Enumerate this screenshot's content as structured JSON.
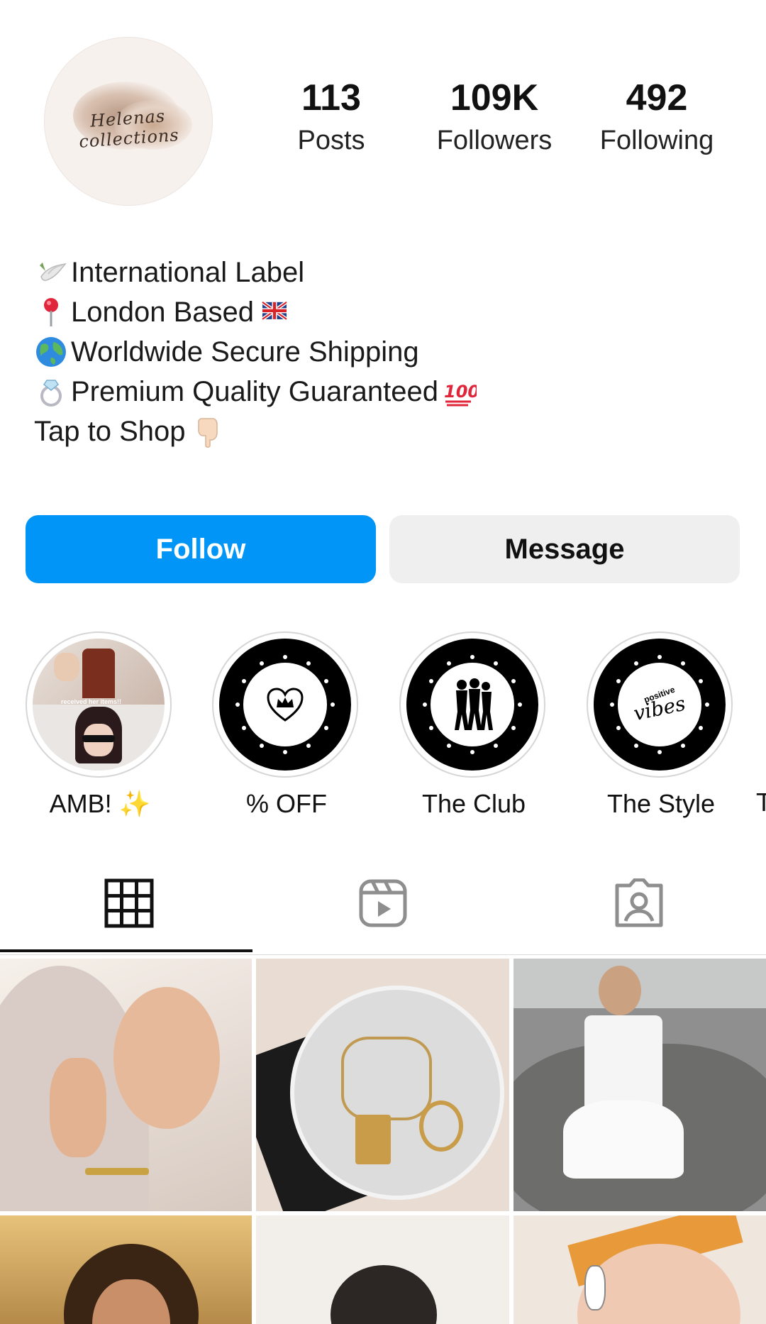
{
  "profile": {
    "avatar_name": "profile-avatar",
    "stats": [
      {
        "value": "113",
        "label": "Posts"
      },
      {
        "value": "109K",
        "label": "Followers"
      },
      {
        "value": "492",
        "label": "Following"
      }
    ],
    "bio": [
      {
        "icon": "dove-icon",
        "text": "International Label"
      },
      {
        "icon": "pin-icon",
        "text": "London Based",
        "after_icon": "uk-flag-icon"
      },
      {
        "icon": "globe-icon",
        "text": "Worldwide Secure Shipping"
      },
      {
        "icon": "ring-icon",
        "text": "Premium Quality Guaranteed ",
        "after_icon": "hundred-points-icon"
      },
      {
        "icon": "",
        "text": "Tap to Shop ",
        "after_icon": "pointing-down-icon"
      }
    ]
  },
  "actions": {
    "follow_label": "Follow",
    "message_label": "Message"
  },
  "highlights": [
    {
      "label": "AMB! ✨",
      "icon": "photo-collage",
      "overlay_text": "received her items!!"
    },
    {
      "label": "% OFF",
      "icon": "heart-crown-icon"
    },
    {
      "label": "The Club",
      "icon": "silhouettes-icon"
    },
    {
      "label": "The Style",
      "icon": "positive-vibes-icon",
      "inner_text_top": "positive",
      "inner_text_bottom": "vibes"
    }
  ],
  "tabs": [
    {
      "name": "grid-icon",
      "active": true
    },
    {
      "name": "reels-icon",
      "active": false
    },
    {
      "name": "tagged-icon",
      "active": false
    }
  ],
  "colors": {
    "follow_blue": "#0095f6",
    "message_gray": "#efefef"
  }
}
